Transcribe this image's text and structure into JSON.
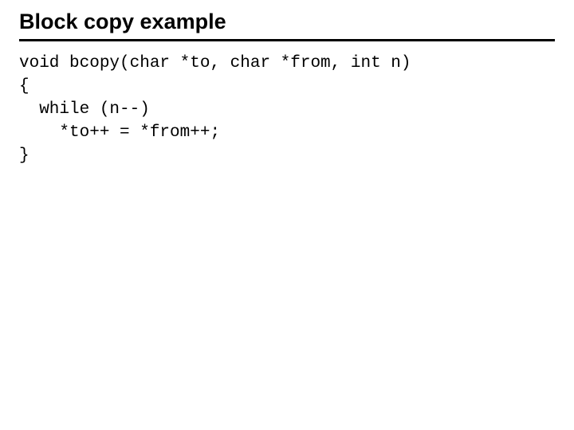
{
  "title": "Block copy example",
  "code": {
    "line1": "void bcopy(char *to, char *from, int n)",
    "line2": "{",
    "line3": "  while (n--)",
    "line4": "    *to++ = *from++;",
    "line5": "}"
  }
}
